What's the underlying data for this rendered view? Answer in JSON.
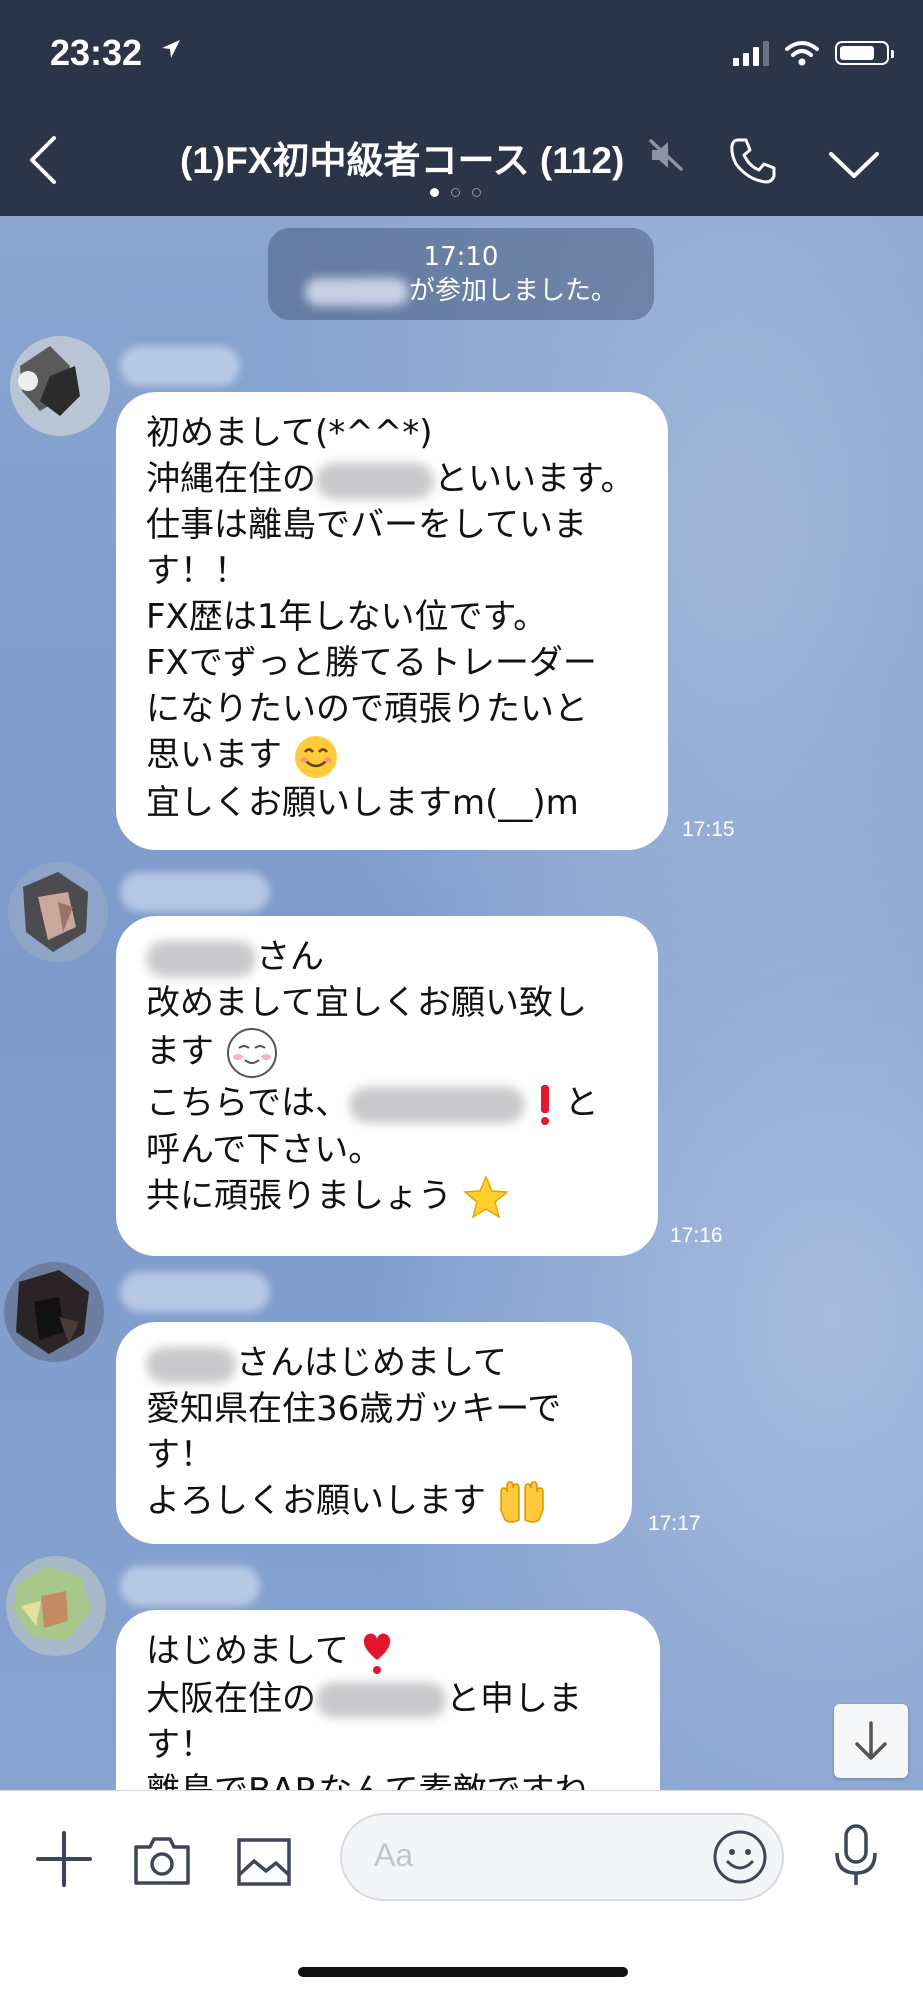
{
  "status_bar": {
    "time": "23:32"
  },
  "header": {
    "title": "(1)FX初中級者コース (112)"
  },
  "system": {
    "time": "17:10",
    "joined_text": "が参加しました。"
  },
  "messages": [
    {
      "lines": [
        "初めまして(*^^*)",
        "沖縄在住の",
        "といいます。",
        "仕事は離島でバーをしていま",
        "す！！",
        "FX歴は1年しない位です。",
        "FXでずっと勝てるトレーダー",
        "になりたいので頑張りたいと",
        "思います",
        "宜しくお願いしますm(__)m"
      ],
      "time": "17:15"
    },
    {
      "lines": [
        "さん",
        "改めまして宜しくお願い致し",
        "ます",
        "こちらでは、",
        "と",
        "呼んで下さい。",
        "共に頑張りましょう"
      ],
      "time": "17:16"
    },
    {
      "lines": [
        "さんはじめまして",
        "愛知県在住36歳ガッキーで",
        "す！",
        "よろしくお願いします"
      ],
      "time": "17:17"
    },
    {
      "lines": [
        "はじめまして",
        "大阪在住の",
        "と申しま",
        "す！",
        "離島でBARなんて素敵ですね"
      ]
    }
  ],
  "input": {
    "placeholder": "Aa"
  },
  "colors": {
    "header_bg": "#2b3548",
    "chat_bg": "#84a1cd",
    "bubble": "#ffffff"
  }
}
